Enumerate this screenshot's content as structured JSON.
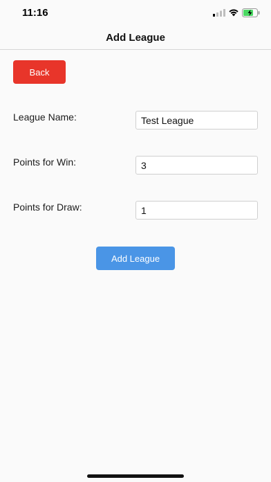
{
  "status_bar": {
    "time": "11:16",
    "icons": [
      "signal-icon",
      "wifi-icon",
      "battery-charging-icon"
    ]
  },
  "nav": {
    "title": "Add League"
  },
  "back_button": {
    "label": "Back"
  },
  "form": {
    "league_name": {
      "label": "League Name:",
      "value": "Test League"
    },
    "points_win": {
      "label": "Points for Win:",
      "value": "3"
    },
    "points_draw": {
      "label": "Points for Draw:",
      "value": "1"
    }
  },
  "submit_button": {
    "label": "Add League"
  },
  "colors": {
    "back_button": "#e8352a",
    "submit_button": "#4a95e6",
    "battery": "#4cd964"
  }
}
